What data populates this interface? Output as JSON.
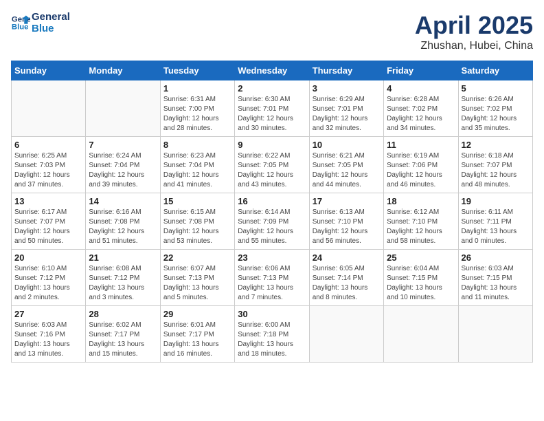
{
  "header": {
    "logo_line1": "General",
    "logo_line2": "Blue",
    "month_title": "April 2025",
    "location": "Zhushan, Hubei, China"
  },
  "weekdays": [
    "Sunday",
    "Monday",
    "Tuesday",
    "Wednesday",
    "Thursday",
    "Friday",
    "Saturday"
  ],
  "weeks": [
    [
      {
        "day": "",
        "info": ""
      },
      {
        "day": "",
        "info": ""
      },
      {
        "day": "1",
        "info": "Sunrise: 6:31 AM\nSunset: 7:00 PM\nDaylight: 12 hours\nand 28 minutes."
      },
      {
        "day": "2",
        "info": "Sunrise: 6:30 AM\nSunset: 7:01 PM\nDaylight: 12 hours\nand 30 minutes."
      },
      {
        "day": "3",
        "info": "Sunrise: 6:29 AM\nSunset: 7:01 PM\nDaylight: 12 hours\nand 32 minutes."
      },
      {
        "day": "4",
        "info": "Sunrise: 6:28 AM\nSunset: 7:02 PM\nDaylight: 12 hours\nand 34 minutes."
      },
      {
        "day": "5",
        "info": "Sunrise: 6:26 AM\nSunset: 7:02 PM\nDaylight: 12 hours\nand 35 minutes."
      }
    ],
    [
      {
        "day": "6",
        "info": "Sunrise: 6:25 AM\nSunset: 7:03 PM\nDaylight: 12 hours\nand 37 minutes."
      },
      {
        "day": "7",
        "info": "Sunrise: 6:24 AM\nSunset: 7:04 PM\nDaylight: 12 hours\nand 39 minutes."
      },
      {
        "day": "8",
        "info": "Sunrise: 6:23 AM\nSunset: 7:04 PM\nDaylight: 12 hours\nand 41 minutes."
      },
      {
        "day": "9",
        "info": "Sunrise: 6:22 AM\nSunset: 7:05 PM\nDaylight: 12 hours\nand 43 minutes."
      },
      {
        "day": "10",
        "info": "Sunrise: 6:21 AM\nSunset: 7:05 PM\nDaylight: 12 hours\nand 44 minutes."
      },
      {
        "day": "11",
        "info": "Sunrise: 6:19 AM\nSunset: 7:06 PM\nDaylight: 12 hours\nand 46 minutes."
      },
      {
        "day": "12",
        "info": "Sunrise: 6:18 AM\nSunset: 7:07 PM\nDaylight: 12 hours\nand 48 minutes."
      }
    ],
    [
      {
        "day": "13",
        "info": "Sunrise: 6:17 AM\nSunset: 7:07 PM\nDaylight: 12 hours\nand 50 minutes."
      },
      {
        "day": "14",
        "info": "Sunrise: 6:16 AM\nSunset: 7:08 PM\nDaylight: 12 hours\nand 51 minutes."
      },
      {
        "day": "15",
        "info": "Sunrise: 6:15 AM\nSunset: 7:08 PM\nDaylight: 12 hours\nand 53 minutes."
      },
      {
        "day": "16",
        "info": "Sunrise: 6:14 AM\nSunset: 7:09 PM\nDaylight: 12 hours\nand 55 minutes."
      },
      {
        "day": "17",
        "info": "Sunrise: 6:13 AM\nSunset: 7:10 PM\nDaylight: 12 hours\nand 56 minutes."
      },
      {
        "day": "18",
        "info": "Sunrise: 6:12 AM\nSunset: 7:10 PM\nDaylight: 12 hours\nand 58 minutes."
      },
      {
        "day": "19",
        "info": "Sunrise: 6:11 AM\nSunset: 7:11 PM\nDaylight: 13 hours\nand 0 minutes."
      }
    ],
    [
      {
        "day": "20",
        "info": "Sunrise: 6:10 AM\nSunset: 7:12 PM\nDaylight: 13 hours\nand 2 minutes."
      },
      {
        "day": "21",
        "info": "Sunrise: 6:08 AM\nSunset: 7:12 PM\nDaylight: 13 hours\nand 3 minutes."
      },
      {
        "day": "22",
        "info": "Sunrise: 6:07 AM\nSunset: 7:13 PM\nDaylight: 13 hours\nand 5 minutes."
      },
      {
        "day": "23",
        "info": "Sunrise: 6:06 AM\nSunset: 7:13 PM\nDaylight: 13 hours\nand 7 minutes."
      },
      {
        "day": "24",
        "info": "Sunrise: 6:05 AM\nSunset: 7:14 PM\nDaylight: 13 hours\nand 8 minutes."
      },
      {
        "day": "25",
        "info": "Sunrise: 6:04 AM\nSunset: 7:15 PM\nDaylight: 13 hours\nand 10 minutes."
      },
      {
        "day": "26",
        "info": "Sunrise: 6:03 AM\nSunset: 7:15 PM\nDaylight: 13 hours\nand 11 minutes."
      }
    ],
    [
      {
        "day": "27",
        "info": "Sunrise: 6:03 AM\nSunset: 7:16 PM\nDaylight: 13 hours\nand 13 minutes."
      },
      {
        "day": "28",
        "info": "Sunrise: 6:02 AM\nSunset: 7:17 PM\nDaylight: 13 hours\nand 15 minutes."
      },
      {
        "day": "29",
        "info": "Sunrise: 6:01 AM\nSunset: 7:17 PM\nDaylight: 13 hours\nand 16 minutes."
      },
      {
        "day": "30",
        "info": "Sunrise: 6:00 AM\nSunset: 7:18 PM\nDaylight: 13 hours\nand 18 minutes."
      },
      {
        "day": "",
        "info": ""
      },
      {
        "day": "",
        "info": ""
      },
      {
        "day": "",
        "info": ""
      }
    ]
  ]
}
